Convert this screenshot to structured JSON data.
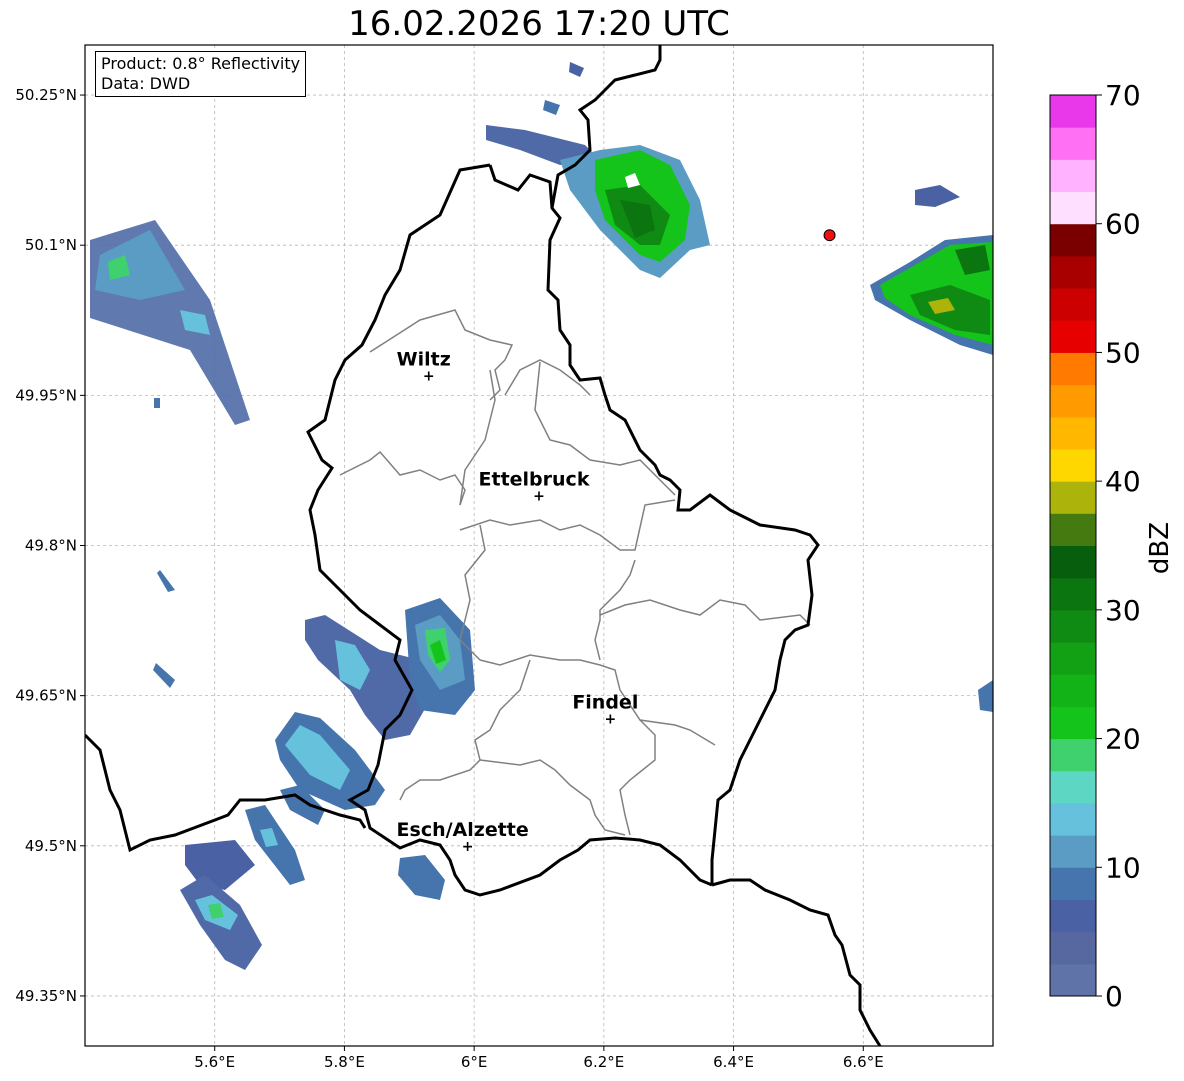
{
  "title": "16.02.2026 17:20 UTC",
  "info": {
    "product": "Product: 0.8° Reflectivity",
    "data": "Data: DWD"
  },
  "axes": {
    "lon_ticks": [
      "5.6°E",
      "5.8°E",
      "6°E",
      "6.2°E",
      "6.4°E",
      "6.6°E"
    ],
    "lat_ticks": [
      "50.25°N",
      "50.1°N",
      "49.95°N",
      "49.8°N",
      "49.65°N",
      "49.5°N",
      "49.35°N"
    ],
    "lon_values": [
      5.6,
      5.8,
      6.0,
      6.2,
      6.4,
      6.6
    ],
    "lat_values": [
      50.25,
      50.1,
      49.95,
      49.8,
      49.65,
      49.5,
      49.35
    ],
    "lon_range": [
      5.4,
      6.8
    ],
    "lat_range": [
      49.3,
      50.3
    ]
  },
  "cities": [
    {
      "name": "Wiltz",
      "lon": 5.93,
      "lat": 49.97
    },
    {
      "name": "Ettelbruck",
      "lon": 6.1,
      "lat": 49.85
    },
    {
      "name": "Findel",
      "lon": 6.21,
      "lat": 49.627
    },
    {
      "name": "Esch/Alzette",
      "lon": 5.99,
      "lat": 49.5
    }
  ],
  "radar_site": {
    "lon": 6.548,
    "lat": 50.11,
    "color": "#ee1111"
  },
  "colorbar": {
    "label": "dBZ",
    "ticks": [
      "0",
      "10",
      "20",
      "30",
      "40",
      "50",
      "60",
      "70"
    ],
    "min": 0,
    "max": 70,
    "step": 2.5,
    "colors": [
      "#6073a8",
      "#56689f",
      "#4a62a3",
      "#4675ae",
      "#5b9cc4",
      "#66c2dc",
      "#5ed6c4",
      "#3fd16e",
      "#14c41a",
      "#12b317",
      "#12a014",
      "#0f8a12",
      "#0b7510",
      "#075e0c",
      "#457a10",
      "#acb30a",
      "#ffd700",
      "#ffb700",
      "#ff9a00",
      "#ff7a00",
      "#e60000",
      "#cc0000",
      "#a80000",
      "#7a0000",
      "#ffdfff",
      "#ffb2ff",
      "#ff70f4",
      "#e838ea"
    ]
  },
  "colors": {
    "border": "#000000",
    "canton": "#808080",
    "grid": "#b8b8b8"
  }
}
